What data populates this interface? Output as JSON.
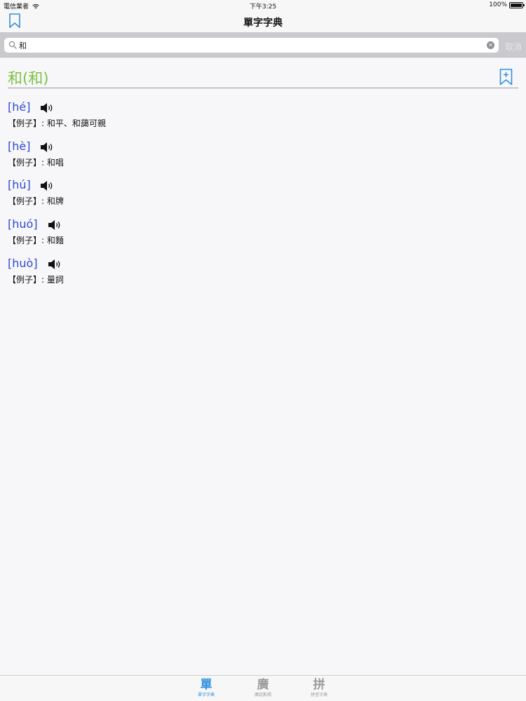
{
  "status_bar": {
    "carrier": "電信業者",
    "time": "下午3:25",
    "battery": "100%"
  },
  "nav": {
    "title": "單字字典",
    "bookmark_icon": "bookmark-list-icon"
  },
  "search": {
    "value": "和",
    "placeholder": "",
    "cancel_label": "取消"
  },
  "entry": {
    "headword": "和(和)",
    "accent_color": "#7ac143",
    "pinyin_color": "#2f49d1",
    "readings": [
      {
        "pinyin": "[hé]",
        "example": "【例子】: 和平、和藹可親"
      },
      {
        "pinyin": "[hè]",
        "example": "【例子】: 和唱"
      },
      {
        "pinyin": "[hú]",
        "example": "【例子】: 和牌"
      },
      {
        "pinyin": "[huó]",
        "example": "【例子】: 和麵"
      },
      {
        "pinyin": "[huò]",
        "example": "【例子】: 量詞"
      }
    ]
  },
  "tabs": [
    {
      "glyph": "單",
      "label": "單字字典",
      "active": true
    },
    {
      "glyph": "廣",
      "label": "廣話對照",
      "active": false
    },
    {
      "glyph": "拼",
      "label": "拼音字典",
      "active": false
    }
  ],
  "tint_color": "#2f8fe0"
}
